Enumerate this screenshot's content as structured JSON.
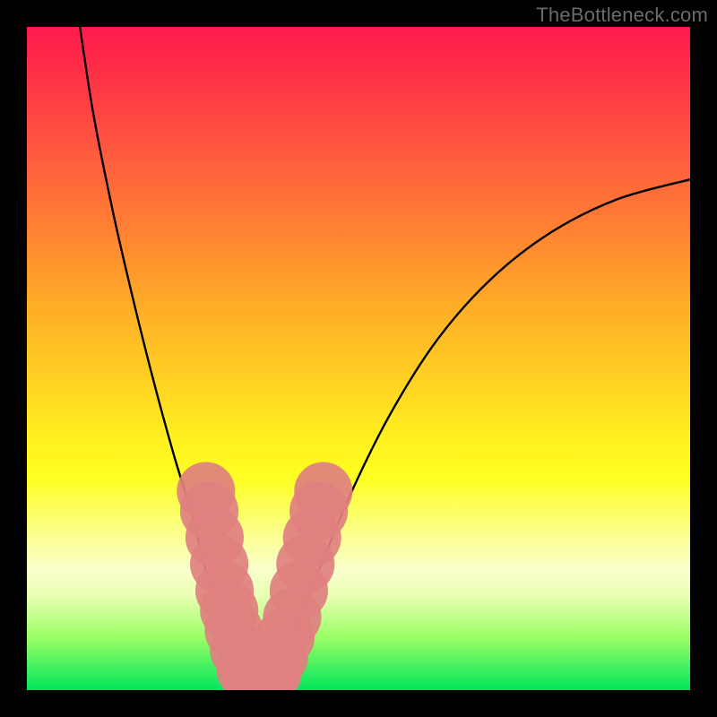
{
  "watermark": "TheBottleneck.com",
  "chart_data": {
    "type": "line",
    "title": "",
    "xlabel": "",
    "ylabel": "",
    "xlim": [
      0,
      100
    ],
    "ylim": [
      0,
      100
    ],
    "gradient_stops": [
      {
        "pos": 0,
        "color": "#ff1a4d"
      },
      {
        "pos": 8,
        "color": "#ff3346"
      },
      {
        "pos": 18,
        "color": "#ff5740"
      },
      {
        "pos": 30,
        "color": "#ff7f33"
      },
      {
        "pos": 42,
        "color": "#ffad27"
      },
      {
        "pos": 54,
        "color": "#ffd322"
      },
      {
        "pos": 62,
        "color": "#fff01f"
      },
      {
        "pos": 68,
        "color": "#ffff22"
      },
      {
        "pos": 78,
        "color": "#fbffa0"
      },
      {
        "pos": 82,
        "color": "#f9ffcc"
      },
      {
        "pos": 86,
        "color": "#e6ffb0"
      },
      {
        "pos": 92,
        "color": "#9bff66"
      },
      {
        "pos": 100,
        "color": "#00e65c"
      }
    ],
    "series": [
      {
        "name": "left-arm",
        "x": [
          8,
          10,
          13,
          16,
          19,
          22,
          25,
          27,
          29,
          31,
          33
        ],
        "y": [
          100,
          87,
          72,
          59,
          47,
          36,
          26,
          18,
          12,
          6,
          1
        ]
      },
      {
        "name": "floor",
        "x": [
          33,
          35,
          37
        ],
        "y": [
          1,
          0.5,
          1
        ]
      },
      {
        "name": "right-arm",
        "x": [
          37,
          40,
          44,
          49,
          55,
          62,
          70,
          79,
          89,
          100
        ],
        "y": [
          1,
          8,
          18,
          30,
          42,
          53,
          62,
          69,
          74,
          77
        ]
      }
    ],
    "markers": {
      "name": "cluster-dots",
      "color": "#e08080",
      "radius": 2.2,
      "points": [
        {
          "x": 27.0,
          "y": 30
        },
        {
          "x": 27.5,
          "y": 27
        },
        {
          "x": 28.3,
          "y": 23
        },
        {
          "x": 29.0,
          "y": 19
        },
        {
          "x": 29.8,
          "y": 15
        },
        {
          "x": 30.5,
          "y": 12
        },
        {
          "x": 31.2,
          "y": 9
        },
        {
          "x": 32.0,
          "y": 6
        },
        {
          "x": 33.0,
          "y": 3
        },
        {
          "x": 34.0,
          "y": 1.2
        },
        {
          "x": 35.0,
          "y": 0.8
        },
        {
          "x": 36.0,
          "y": 1.2
        },
        {
          "x": 37.0,
          "y": 2.5
        },
        {
          "x": 38.0,
          "y": 5
        },
        {
          "x": 39.0,
          "y": 8
        },
        {
          "x": 40.0,
          "y": 11
        },
        {
          "x": 41.0,
          "y": 15
        },
        {
          "x": 42.0,
          "y": 19
        },
        {
          "x": 43.0,
          "y": 23
        },
        {
          "x": 44.0,
          "y": 27
        },
        {
          "x": 44.7,
          "y": 30
        }
      ]
    }
  }
}
